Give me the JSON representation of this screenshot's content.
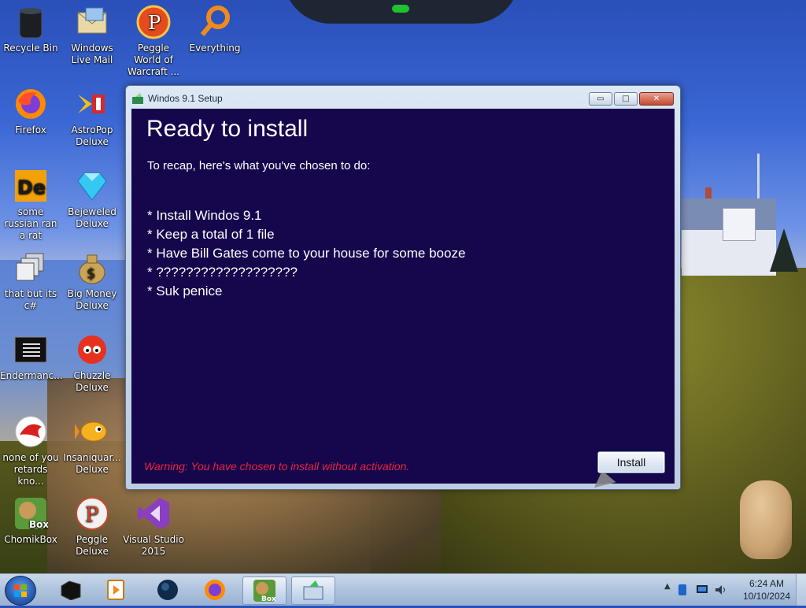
{
  "desktop": {
    "icons": [
      {
        "label": "Recycle Bin",
        "icon": "recycle-bin-icon"
      },
      {
        "label": "Windows Live Mail",
        "icon": "mail-icon"
      },
      {
        "label": "Peggle World of Warcraft ...",
        "icon": "peggle-icon"
      },
      {
        "label": "Everything",
        "icon": "search-icon"
      },
      {
        "label": "Firefox",
        "icon": "firefox-icon"
      },
      {
        "label": "AstroPop Deluxe",
        "icon": "astropop-icon"
      },
      {
        "label": "some russian ran a rat",
        "icon": "de-icon"
      },
      {
        "label": "Bejeweled Deluxe",
        "icon": "gem-icon"
      },
      {
        "label": "that but its c#",
        "icon": "windows-stack-icon"
      },
      {
        "label": "Big Money Deluxe",
        "icon": "money-bag-icon"
      },
      {
        "label": "Endermanc...",
        "icon": "terminal-icon"
      },
      {
        "label": "Chuzzle Deluxe",
        "icon": "chuzzle-icon"
      },
      {
        "label": "none of you retards kno...",
        "icon": "red-bird-icon"
      },
      {
        "label": "Insaniquar... Deluxe",
        "icon": "fish-icon"
      },
      {
        "label": "ChomikBox",
        "icon": "chomikbox-icon"
      },
      {
        "label": "Peggle Deluxe",
        "icon": "peggle-icon"
      },
      {
        "label": "Visual Studio 2015",
        "icon": "visual-studio-icon"
      }
    ]
  },
  "window": {
    "title": "Windos 9.1 Setup",
    "heading": "Ready to install",
    "recap": "To recap, here's what you've chosen to do:",
    "items": [
      "* Install Windos 9.1",
      "* Keep a total of 1 file",
      "* Have Bill Gates come to your house for some booze",
      "* ???????????????????",
      "* Suk penice"
    ],
    "warning": "Warning: You have chosen to install without activation.",
    "install_label": "Install",
    "controls": {
      "minimize": "▭",
      "maximize": "□",
      "close": "✕"
    }
  },
  "taskbar": {
    "items": [
      {
        "icon": "start-orb-icon"
      },
      {
        "icon": "black-box-icon"
      },
      {
        "icon": "media-player-icon"
      },
      {
        "icon": "globe-icon"
      },
      {
        "icon": "firefox-icon"
      },
      {
        "icon": "chomikbox-icon",
        "active": true
      },
      {
        "icon": "setup-icon",
        "active": true
      }
    ],
    "tray": {
      "time": "6:24 AM",
      "date": "10/10/2024",
      "chevron": "▲",
      "icons": [
        "bluetooth-icon",
        "network-monitor-icon",
        "volume-icon"
      ]
    }
  },
  "colors": {
    "window_bg": "#16074d",
    "warning": "#e8253b",
    "taskbar": "#b4cae8"
  }
}
